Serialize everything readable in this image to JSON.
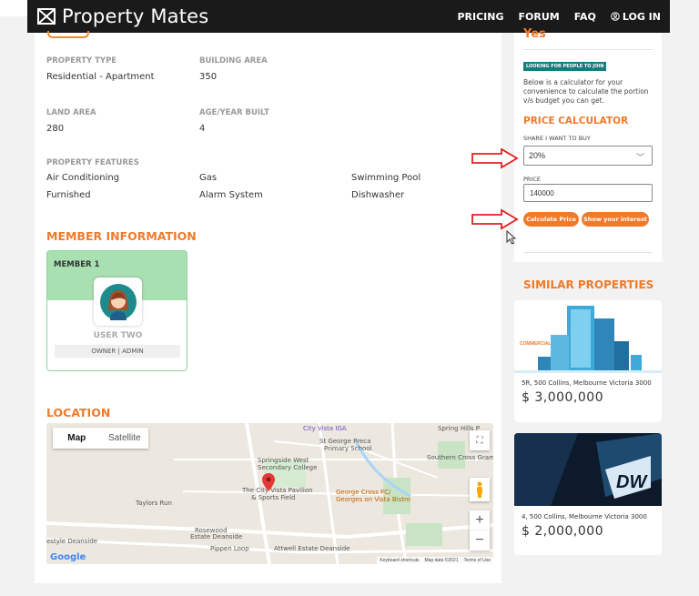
{
  "brand": {
    "name": "Property Mates"
  },
  "nav": {
    "pricing": "PRICING",
    "forum": "FORUM",
    "faq": "FAQ",
    "login": "LOG IN"
  },
  "details": {
    "property_type_label": "PROPERTY TYPE",
    "property_type_value": "Residential - Apartment",
    "building_area_label": "BUILDING AREA",
    "building_area_value": "350",
    "land_area_label": "LAND AREA",
    "land_area_value": "280",
    "age_label": "AGE/YEAR BUILT",
    "age_value": "4",
    "features_label": "PROPERTY FEATURES",
    "features": [
      "Air Conditioning",
      "Gas",
      "Swimming Pool",
      "Furnished",
      "Alarm System",
      "Dishwasher"
    ]
  },
  "members": {
    "title": "MEMBER INFORMATION",
    "card_title": "MEMBER 1",
    "name": "USER TWO",
    "role": "OWNER | ADMIN"
  },
  "location": {
    "title": "LOCATION",
    "map_tab": "Map",
    "satellite_tab": "Satellite",
    "labels": {
      "city_vista_iga": "City Vista IGA",
      "st_george": "St George Preca",
      "primary_school": "Primary School",
      "spring_hills": "Spring Hills P",
      "southern_cross": "Southern Cross Gram",
      "springside": "Springside West",
      "secondary_college": "Secondary College",
      "city_vista_pavilion": "The City Vista Pavilion",
      "sports_field": "& Sports Field",
      "george_cross": "George Cross FC/",
      "georges_bistro": "Georges on Vista Bistro",
      "taylors_run": "Taylors Run",
      "rosewood": "Rosewood",
      "estate_deanside": "Estate Deanside",
      "pippen_loop": "Pippen Loop",
      "attwell": "Attwell Estate Deanside",
      "estyle": "estyle Deanside"
    },
    "google": "Google",
    "footer": [
      "Keyboard shortcuts",
      "Map data ©2021",
      "Terms of Use"
    ]
  },
  "sidebar": {
    "status": "Yes",
    "badge": "LOOKING FOR PEOPLE TO JOIN",
    "description": "Below is a calculator for your convenience to calculate the portion v/s budget you can get.",
    "calc_title": "PRICE CALCULATOR",
    "share_label": "SHARE I WANT TO BUY",
    "share_value": "20%",
    "price_label": "PRICE",
    "price_value": "140000",
    "calc_button": "Calculate Price",
    "interest_button": "Show your interest"
  },
  "similar": {
    "title": "SIMILAR PROPERTIES",
    "items": [
      {
        "tag": "COMMERCIAL",
        "address": "5R, 500 Collins, Melbourne Victoria 3000",
        "price": "$ 3,000,000"
      },
      {
        "tag": "DW",
        "address": "4, 500 Collins, Melbourne Victoria 3000",
        "price": "$ 2,000,000"
      }
    ]
  },
  "colors": {
    "accent": "#f07a2a",
    "nav_bg": "#1a1a1a",
    "badge": "#167d7f",
    "arrow": "#e02020"
  }
}
